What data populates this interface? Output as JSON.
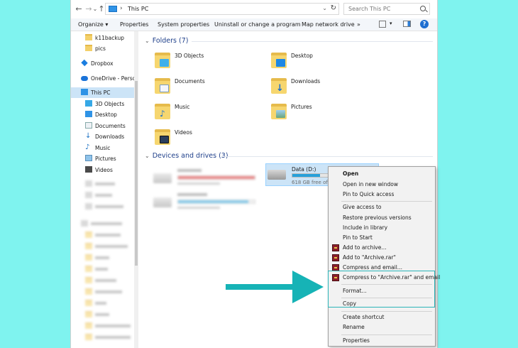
{
  "address": {
    "back": "←",
    "forward": "→",
    "dropdown": "⌄",
    "up": "↑",
    "path_separator": "›",
    "path": "This PC",
    "search_placeholder": "Search This PC"
  },
  "toolbar": {
    "items": [
      "Organize ▾",
      "Properties",
      "System properties",
      "Uninstall or change a program",
      "Map network drive",
      "»"
    ],
    "help": "?"
  },
  "navpane": {
    "items": [
      {
        "label": "k11backup",
        "icon": "folder-icon"
      },
      {
        "label": "pics",
        "icon": "folder-icon"
      },
      {
        "label": "Dropbox",
        "icon": "dropbox-icon"
      },
      {
        "label": "OneDrive - Person",
        "icon": "onedrive-icon"
      },
      {
        "label": "This PC",
        "icon": "pc-icon"
      },
      {
        "label": "3D Objects",
        "icon": "3d-objects-icon"
      },
      {
        "label": "Desktop",
        "icon": "desktop-icon"
      },
      {
        "label": "Documents",
        "icon": "documents-icon"
      },
      {
        "label": "Downloads",
        "icon": "downloads-icon"
      },
      {
        "label": "Music",
        "icon": "music-icon"
      },
      {
        "label": "Pictures",
        "icon": "pictures-icon"
      },
      {
        "label": "Videos",
        "icon": "videos-icon"
      }
    ]
  },
  "folders": {
    "header": "Folders (7)",
    "items": [
      {
        "label": "3D Objects",
        "icon": "3d-objects-folder-icon"
      },
      {
        "label": "Desktop",
        "icon": "desktop-folder-icon"
      },
      {
        "label": "Documents",
        "icon": "documents-folder-icon"
      },
      {
        "label": "Downloads",
        "icon": "downloads-folder-icon"
      },
      {
        "label": "Music",
        "icon": "music-folder-icon"
      },
      {
        "label": "Pictures",
        "icon": "pictures-folder-icon"
      },
      {
        "label": "Videos",
        "icon": "videos-folder-icon"
      }
    ]
  },
  "drives": {
    "header": "Devices and drives (3)",
    "selected": {
      "label": "Data (D:)",
      "free": "618 GB free of",
      "fill": 0.4
    }
  },
  "context_menu": {
    "items": [
      "Open",
      "Open in new window",
      "Pin to Quick access",
      "Give access to",
      "Restore previous versions",
      "Include in library",
      "Pin to Start",
      "Add to archive...",
      "Add to \"Archive.rar\"",
      "Compress and email...",
      "Compress to \"Archive.rar\" and email",
      "Format...",
      "Copy",
      "Create shortcut",
      "Rename",
      "Properties"
    ]
  },
  "colors": {
    "accent_arrow": "#16b3b6",
    "background": "#7ff3ef",
    "selection": "#cce4f7"
  }
}
